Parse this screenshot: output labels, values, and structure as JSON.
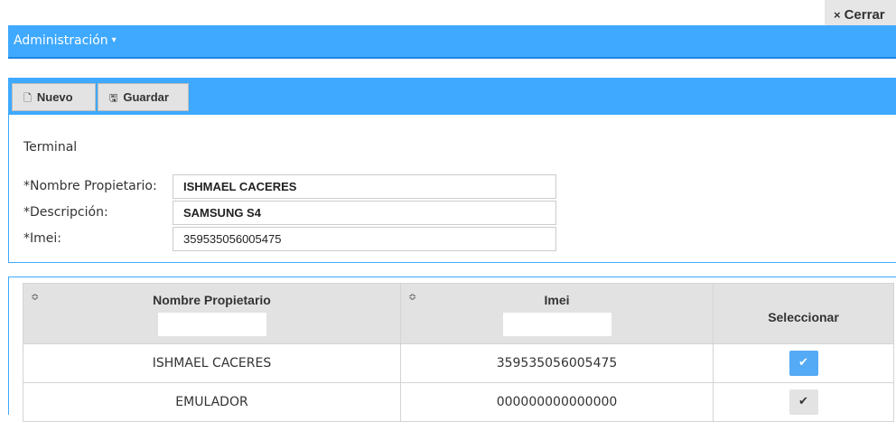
{
  "close": {
    "label": "Cerrar",
    "icon": "close-icon",
    "glyph": "×"
  },
  "menubar": {
    "menu_label": "Administración",
    "caret": "▾"
  },
  "toolbar": {
    "nuevo": {
      "label": "Nuevo",
      "icon": "new-document-icon",
      "glyph": "🗋"
    },
    "guardar": {
      "label": "Guardar",
      "icon": "save-icon",
      "glyph": "🖫"
    }
  },
  "form": {
    "section_title": "Terminal",
    "fields": [
      {
        "label": "*Nombre Propietario:",
        "value": "ISHMAEL CACERES"
      },
      {
        "label": "*Descripción:",
        "value": "SAMSUNG S4"
      },
      {
        "label": "*Imei:",
        "value": "359535056005475"
      }
    ]
  },
  "grid": {
    "sort_glyph": "≎",
    "columns": [
      "Nombre Propietario",
      "Imei",
      "Seleccionar"
    ],
    "rows": [
      {
        "nombre": "ISHMAEL CACERES",
        "imei": "359535056005475",
        "selected": true
      },
      {
        "nombre": "EMULADOR",
        "imei": "000000000000000",
        "selected": false
      }
    ],
    "check_glyph": "✔"
  },
  "colors": {
    "accent": "#3fa9ff",
    "button": "#e3e3e3",
    "header": "#e2e2e2",
    "check_on": "#55aaf5"
  }
}
